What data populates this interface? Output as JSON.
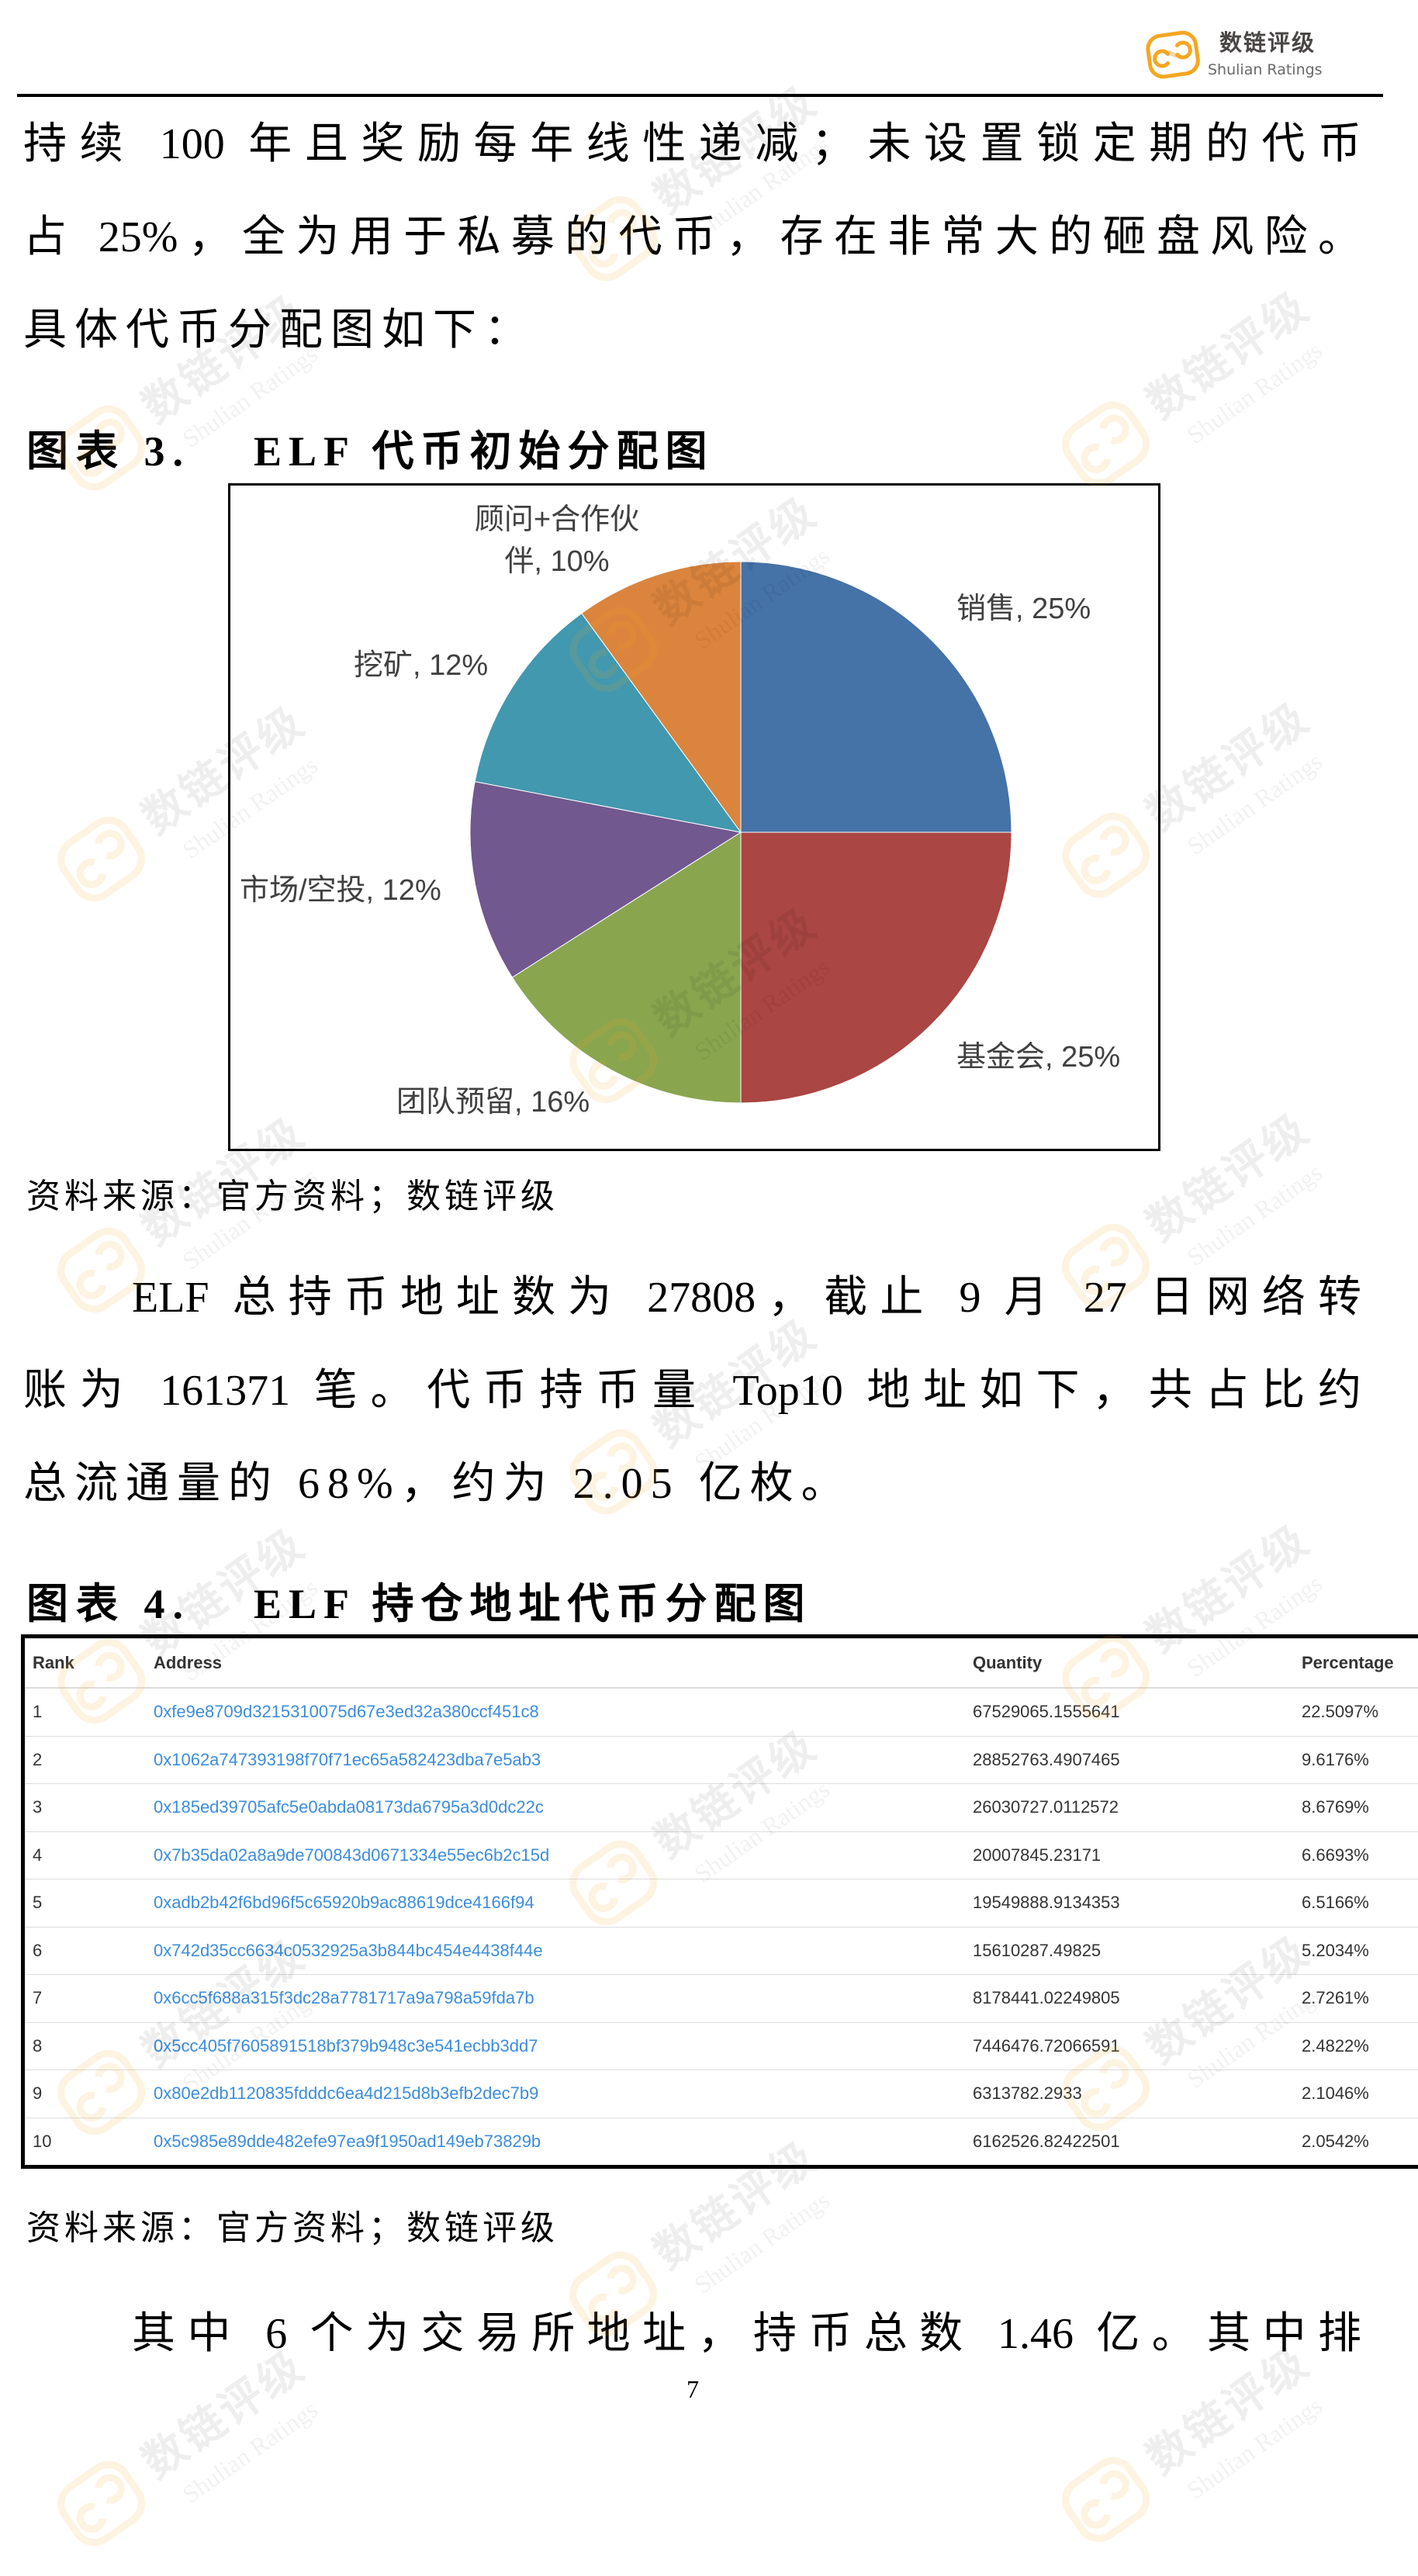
{
  "header": {
    "logo": {
      "icon": "shulian-ratings-logo-icon",
      "name_cn": "数链评级",
      "name_en": "Shulian Ratings",
      "brand_color": "#F5A623"
    }
  },
  "intro_paragraph": {
    "lines": [
      "持续 100 年且奖励每年线性递减；未设置锁定期的代币",
      "占 25%，全为用于私募的代币，存在非常大的砸盘风险。",
      "具体代币分配图如下："
    ]
  },
  "figure_3": {
    "label": "图表 3.",
    "title": "ELF 代币初始分配图",
    "source": "资料来源：官方资料；数链评级"
  },
  "chart_data": {
    "type": "pie",
    "title": "ELF 代币初始分配图",
    "categories": [
      "销售",
      "基金会",
      "团队预留",
      "市场/空投",
      "挖矿",
      "顾问+合作伙伴"
    ],
    "values": [
      25,
      25,
      16,
      12,
      12,
      10
    ],
    "unit": "%",
    "colors": [
      "#4572A7",
      "#AA4643",
      "#89A54E",
      "#71588F",
      "#4198AF",
      "#DB843D"
    ],
    "data_labels": [
      "销售, 25%",
      "基金会, 25%",
      "团队预留, 16%",
      "市场/空投, 12%",
      "挖矿, 12%",
      "顾问+合作伙伴, 10%"
    ],
    "start": "top",
    "direction": "clockwise",
    "legend": "none",
    "xlabel": "",
    "ylabel": ""
  },
  "holders_paragraph": {
    "lines": [
      "ELF 总持币地址数为 27808，截止 9 月 27 日网络转",
      "账为 161371 笔。代币持币量 Top10 地址如下，共占比约",
      "总流通量的 68%，约为 2.05 亿枚。"
    ]
  },
  "figure_4": {
    "label": "图表 4.",
    "title": "ELF 持仓地址代币分配图",
    "link_color": "#3C8DDB",
    "table": {
      "columns": [
        "Rank",
        "Address",
        "Quantity",
        "Percentage"
      ],
      "rows": [
        {
          "rank": "1",
          "address": "0xfe9e8709d3215310075d67e3ed32a380ccf451c8",
          "quantity": "67529065.1555641",
          "percentage": "22.5097%"
        },
        {
          "rank": "2",
          "address": "0x1062a747393198f70f71ec65a582423dba7e5ab3",
          "quantity": "28852763.4907465",
          "percentage": "9.6176%"
        },
        {
          "rank": "3",
          "address": "0x185ed39705afc5e0abda08173da6795a3d0dc22c",
          "quantity": "26030727.0112572",
          "percentage": "8.6769%"
        },
        {
          "rank": "4",
          "address": "0x7b35da02a8a9de700843d0671334e55ec6b2c15d",
          "quantity": "20007845.23171",
          "percentage": "6.6693%"
        },
        {
          "rank": "5",
          "address": "0xadb2b42f6bd96f5c65920b9ac88619dce4166f94",
          "quantity": "19549888.9134353",
          "percentage": "6.5166%"
        },
        {
          "rank": "6",
          "address": "0x742d35cc6634c0532925a3b844bc454e4438f44e",
          "quantity": "15610287.49825",
          "percentage": "5.2034%"
        },
        {
          "rank": "7",
          "address": "0x6cc5f688a315f3dc28a7781717a9a798a59fda7b",
          "quantity": "8178441.02249805",
          "percentage": "2.7261%"
        },
        {
          "rank": "8",
          "address": "0x5cc405f7605891518bf379b948c3e541ecbb3dd7",
          "quantity": "7446476.72066591",
          "percentage": "2.4822%"
        },
        {
          "rank": "9",
          "address": "0x80e2db1120835fdddc6ea4d215d8b3efb2dec7b9",
          "quantity": "6313782.2933",
          "percentage": "2.1046%"
        },
        {
          "rank": "10",
          "address": "0x5c985e89dde482efe97ea9f1950ad149eb73829b",
          "quantity": "6162526.82422501",
          "percentage": "2.0542%"
        }
      ]
    },
    "source": "资料来源：官方资料；数链评级"
  },
  "exchange_paragraph": {
    "lines": [
      "其中 6 个为交易所地址，持币总数 1.46 亿。其中排"
    ]
  },
  "page_number": "7",
  "watermark": {
    "cn": "数链评级",
    "en": "Shulian Ratings",
    "icon": "shulian-ratings-logo-icon"
  }
}
